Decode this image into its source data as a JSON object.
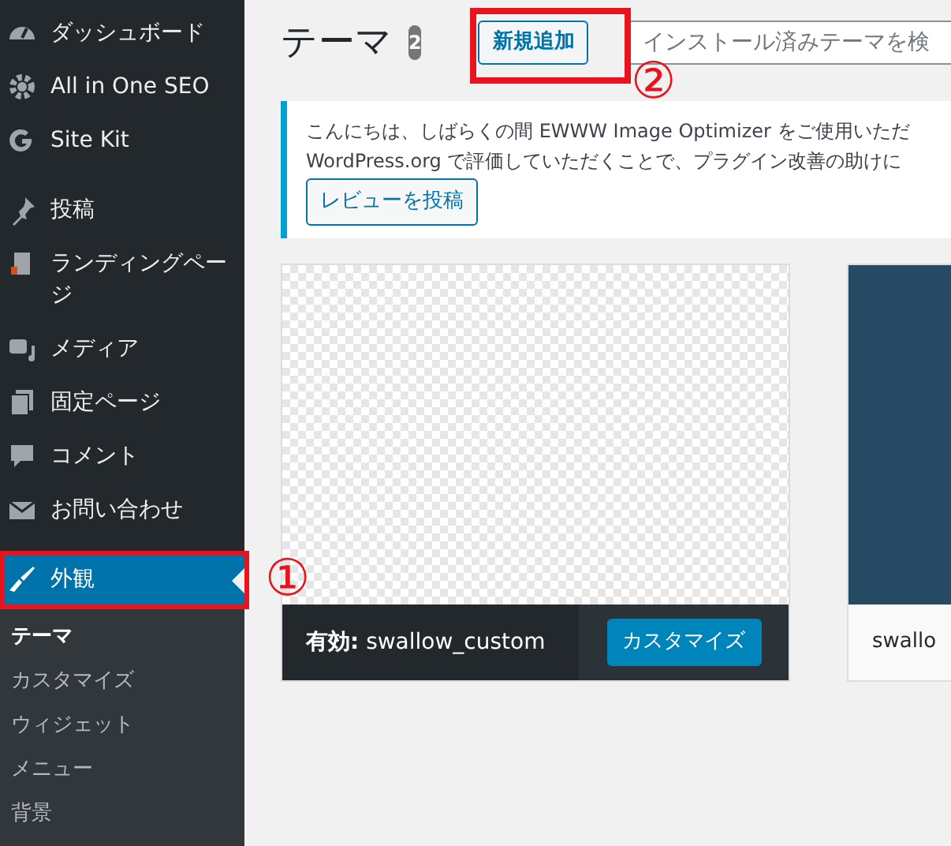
{
  "sidebar": {
    "menu": [
      {
        "label": "ダッシュボード",
        "selected": false
      },
      {
        "label": "All in One SEO",
        "selected": false
      },
      {
        "label": "Site Kit",
        "selected": false
      },
      {
        "label": "投稿",
        "selected": false
      },
      {
        "label": "ランディングページ",
        "selected": false
      },
      {
        "label": "メディア",
        "selected": false
      },
      {
        "label": "固定ページ",
        "selected": false
      },
      {
        "label": "コメント",
        "selected": false
      },
      {
        "label": "お問い合わせ",
        "selected": false
      },
      {
        "label": "外観",
        "selected": true
      }
    ],
    "submenu": [
      {
        "label": "テーマ",
        "selected": true
      },
      {
        "label": "カスタマイズ",
        "selected": false
      },
      {
        "label": "ウィジェット",
        "selected": false
      },
      {
        "label": "メニュー",
        "selected": false
      },
      {
        "label": "背景",
        "selected": false
      }
    ]
  },
  "header": {
    "title": "テーマ",
    "count": "2",
    "add_button": "新規追加",
    "search": {
      "placeholder": "インストール済みテーマを検"
    }
  },
  "notice": {
    "lines": [
      "こんにちは、しばらくの間 EWWW Image Optimizer をご使用いただ",
      "WordPress.org で評価していただくことで、プラグイン改善の助けに"
    ],
    "button": "レビューを投稿"
  },
  "themes": [
    {
      "active": true,
      "status": "有効:",
      "name": "swallow_custom",
      "action": "カスタマイズ"
    },
    {
      "active": false,
      "name": "swallo"
    }
  ],
  "annotations": [
    {
      "number": "①"
    },
    {
      "number": "②"
    }
  ]
}
